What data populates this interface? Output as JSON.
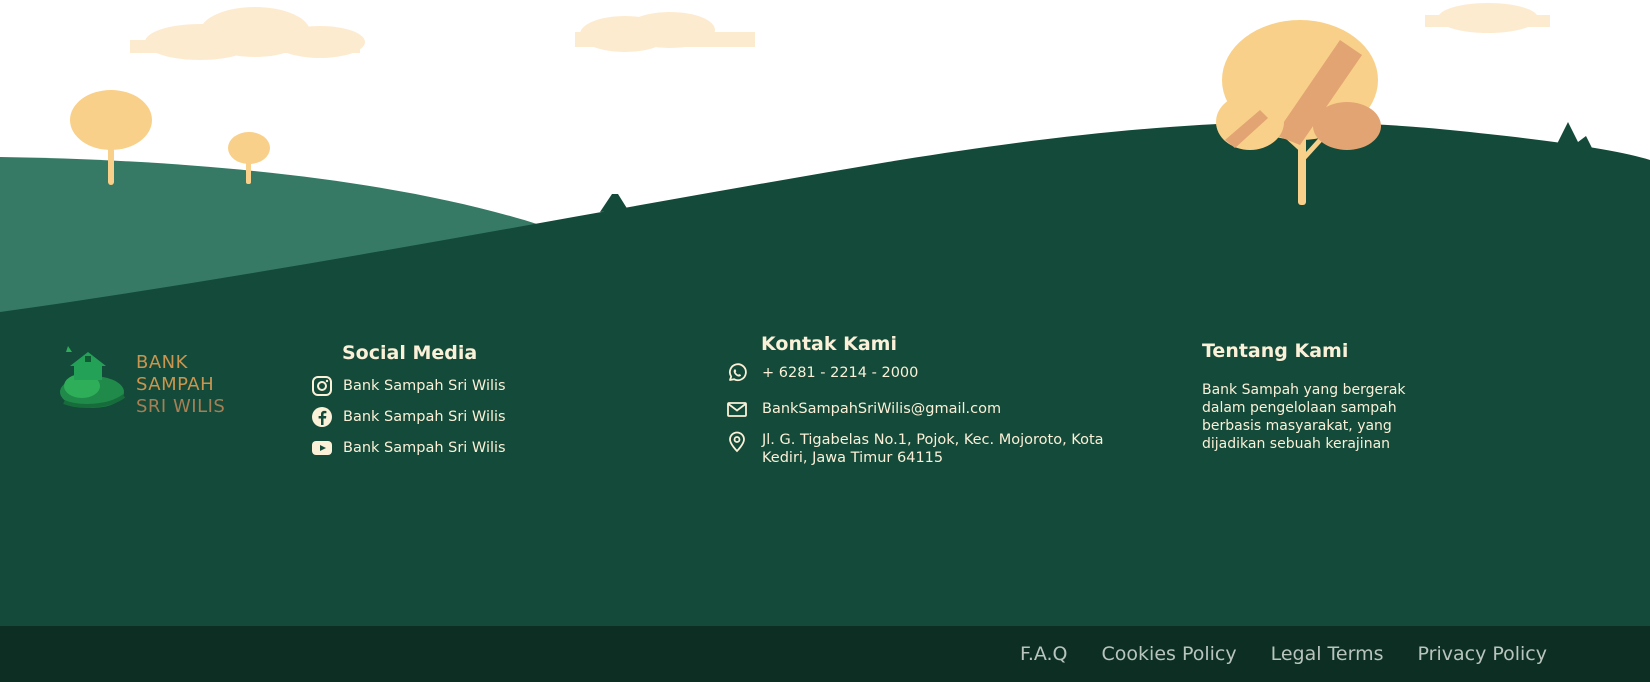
{
  "brand": {
    "line1": "BANK SAMPAH",
    "line2": "SRI WILIS"
  },
  "social": {
    "title": "Social Media",
    "items": [
      {
        "icon": "instagram-icon",
        "label": "Bank Sampah Sri Wilis"
      },
      {
        "icon": "facebook-icon",
        "label": "Bank Sampah Sri Wilis"
      },
      {
        "icon": "youtube-icon",
        "label": "Bank Sampah Sri Wilis"
      }
    ]
  },
  "contact": {
    "title": "Kontak Kami",
    "phone": "+ 6281 - 2214 - 2000",
    "email": "BankSampahSriWilis@gmail.com",
    "address_line1": "Jl. G. Tigabelas No.1, Pojok, Kec. Mojoroto, Kota",
    "address_line2": "Kediri, Jawa Timur 64115"
  },
  "about": {
    "title": "Tentang Kami",
    "text": "Bank Sampah yang bergerak dalam pengelolaan sampah berbasis masyarakat, yang dijadikan sebuah kerajinan"
  },
  "footer_links": [
    "F.A.Q",
    "Cookies Policy",
    "Legal Terms",
    "Privacy Policy"
  ],
  "colors": {
    "dark_green": "#144a39",
    "light_green": "#367a65",
    "bar": "#0d2f23",
    "cream": "#fbf0d8",
    "tree": "#f9d089",
    "cloud": "#fdebd0"
  }
}
